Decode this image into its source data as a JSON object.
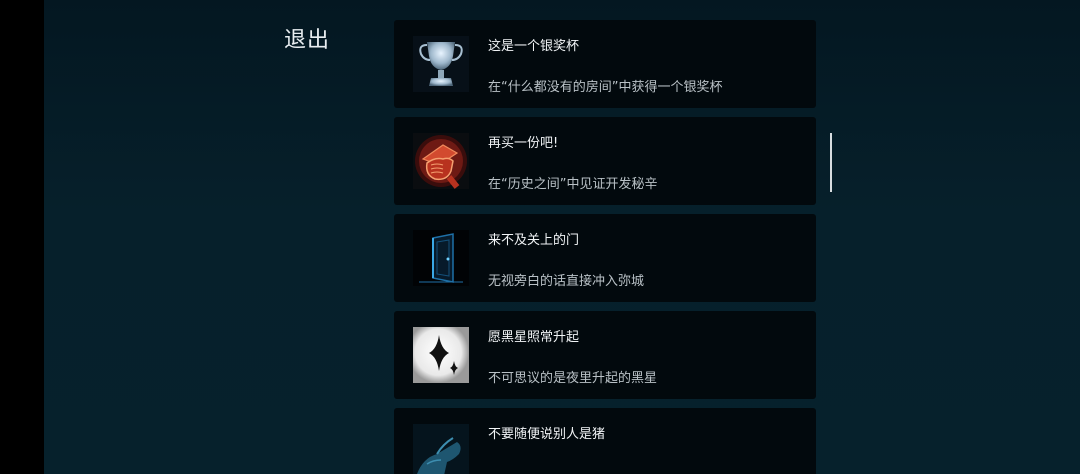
{
  "header": {
    "exit_label": "退出"
  },
  "achievements": [
    {
      "title": "这是一个银奖杯",
      "desc": "在“什么都没有的房间”中获得一个银奖杯",
      "icon": "trophy-icon"
    },
    {
      "title": "再买一份吧!",
      "desc": "在“历史之间”中见证开发秘辛",
      "icon": "fist-icon"
    },
    {
      "title": "来不及关上的门",
      "desc": "无视旁白的话直接冲入弥城",
      "icon": "door-icon"
    },
    {
      "title": "愿黑星照常升起",
      "desc": "不可思议的是夜里升起的黑星",
      "icon": "black-star-icon"
    },
    {
      "title": "不要随便说别人是猪",
      "desc": "",
      "icon": "hand-icon"
    }
  ],
  "colors": {
    "background": "#06202b",
    "card": "#02090d",
    "text": "#f1f4f6"
  }
}
